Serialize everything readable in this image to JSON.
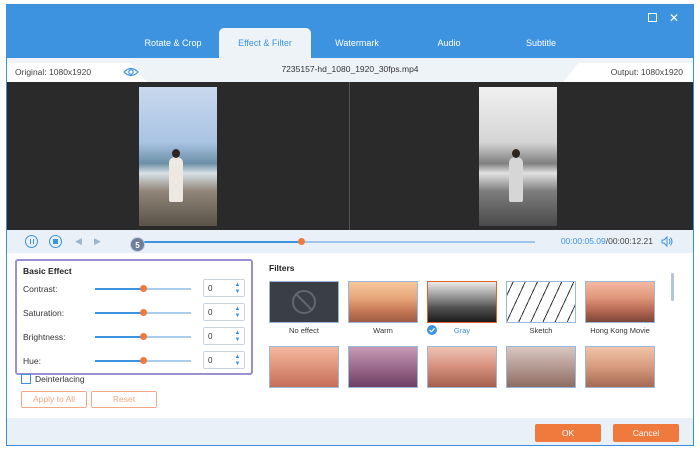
{
  "window": {
    "maximize_icon": "maximize-icon",
    "close_icon": "close-icon"
  },
  "tabs": [
    {
      "label": "Rotate & Crop",
      "active": false
    },
    {
      "label": "Effect & Filter",
      "active": true
    },
    {
      "label": "Watermark",
      "active": false
    },
    {
      "label": "Audio",
      "active": false
    },
    {
      "label": "Subtitle",
      "active": false
    }
  ],
  "infobar": {
    "original": "Original: 1080x1920",
    "filename": "7235157-hd_1080_1920_30fps.mp4",
    "output": "Output: 1080x1920"
  },
  "playback": {
    "current": "00:00:05.09",
    "total": "/00:00:12.21",
    "progress": 0.42,
    "step_badge": "5"
  },
  "basic_effect": {
    "title": "Basic Effect",
    "rows": [
      {
        "label": "Contrast:",
        "value": "0",
        "level": 0.5
      },
      {
        "label": "Saturation:",
        "value": "0",
        "level": 0.5
      },
      {
        "label": "Brightness:",
        "value": "0",
        "level": 0.5
      },
      {
        "label": "Hue:",
        "value": "0",
        "level": 0.5
      }
    ],
    "deinterlacing": "Deinterlacing",
    "apply_all": "Apply to All",
    "reset": "Reset"
  },
  "filters": {
    "title": "Filters",
    "items": [
      {
        "label": "No effect",
        "selected": false
      },
      {
        "label": "Warm",
        "selected": false
      },
      {
        "label": "Gray",
        "selected": true
      },
      {
        "label": "Sketch",
        "selected": false
      },
      {
        "label": "Hong Kong Movie",
        "selected": false
      }
    ]
  },
  "footer": {
    "ok": "OK",
    "cancel": "Cancel"
  },
  "colors": {
    "accent": "#3d93e0",
    "action": "#f07a3e",
    "highlight": "#9b8ed1"
  }
}
